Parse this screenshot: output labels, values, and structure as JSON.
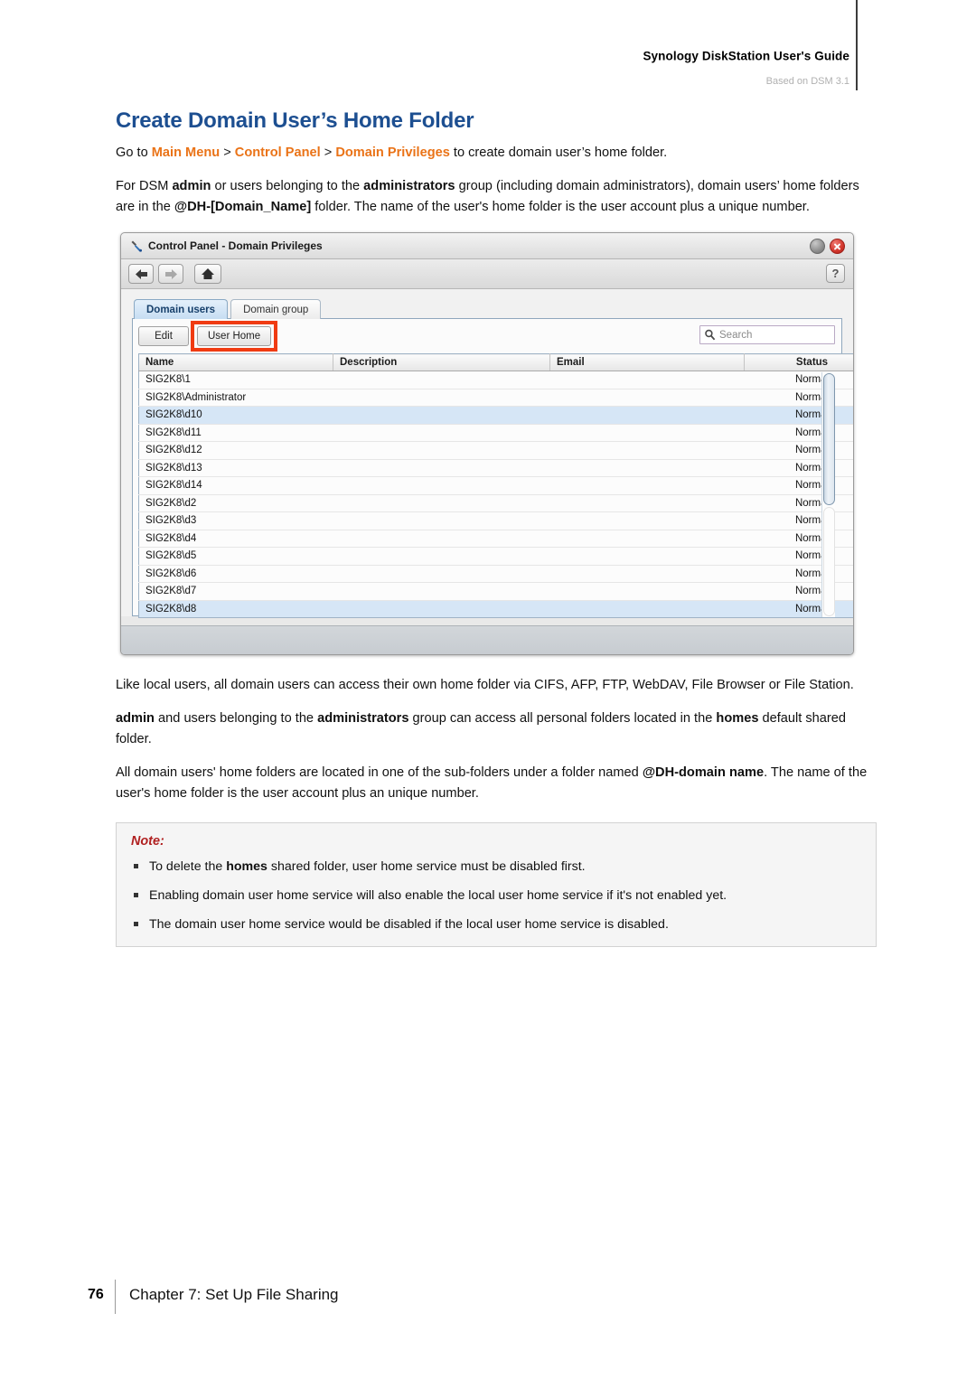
{
  "header": {
    "title": "Synology DiskStation User's Guide",
    "subtitle": "Based on DSM 3.1"
  },
  "page_title": "Create Domain User’s Home Folder",
  "intro": {
    "go_to_prefix": "Go to ",
    "nav1": "Main Menu",
    "nav_sep": " > ",
    "nav2": "Control Panel",
    "nav3": "Domain Privileges",
    "go_to_suffix": " to create domain user’s home folder."
  },
  "paragraph_admin": {
    "s1": "For DSM ",
    "b1": "admin",
    "s2": " or users belonging to the ",
    "b2": "administrators",
    "s3": " group (including domain administrators), domain users’ home folders are in the ",
    "b3": "@DH-[Domain_Name]",
    "s4": " folder. The name of the user's home folder is the user account plus a unique number."
  },
  "screenshot": {
    "window_title": "Control Panel - Domain Privileges",
    "title_icon": "wrench-icon",
    "minimize_label": "",
    "close_label": "",
    "help_label": "?",
    "toolbar": {
      "back": "back-arrow",
      "forward": "forward-arrow",
      "home": "home-icon"
    },
    "tabs": [
      {
        "label": "Domain users",
        "active": true
      },
      {
        "label": "Domain group",
        "active": false
      }
    ],
    "buttons": [
      {
        "label": "Edit",
        "highlighted": false
      },
      {
        "label": "User Home",
        "highlighted": true
      }
    ],
    "search": {
      "placeholder": "Search",
      "value": ""
    },
    "columns": [
      "Name",
      "Description",
      "Email",
      "Status"
    ],
    "rows": [
      {
        "name": "SIG2K8\\1",
        "description": "",
        "email": "",
        "status": "Normal",
        "selected": false
      },
      {
        "name": "SIG2K8\\Administrator",
        "description": "",
        "email": "",
        "status": "Normal",
        "selected": false
      },
      {
        "name": "SIG2K8\\d10",
        "description": "",
        "email": "",
        "status": "Normal",
        "selected": true
      },
      {
        "name": "SIG2K8\\d11",
        "description": "",
        "email": "",
        "status": "Normal",
        "selected": false
      },
      {
        "name": "SIG2K8\\d12",
        "description": "",
        "email": "",
        "status": "Normal",
        "selected": false
      },
      {
        "name": "SIG2K8\\d13",
        "description": "",
        "email": "",
        "status": "Normal",
        "selected": false
      },
      {
        "name": "SIG2K8\\d14",
        "description": "",
        "email": "",
        "status": "Normal",
        "selected": false
      },
      {
        "name": "SIG2K8\\d2",
        "description": "",
        "email": "",
        "status": "Normal",
        "selected": false
      },
      {
        "name": "SIG2K8\\d3",
        "description": "",
        "email": "",
        "status": "Normal",
        "selected": false
      },
      {
        "name": "SIG2K8\\d4",
        "description": "",
        "email": "",
        "status": "Normal",
        "selected": false
      },
      {
        "name": "SIG2K8\\d5",
        "description": "",
        "email": "",
        "status": "Normal",
        "selected": false
      },
      {
        "name": "SIG2K8\\d6",
        "description": "",
        "email": "",
        "status": "Normal",
        "selected": false
      },
      {
        "name": "SIG2K8\\d7",
        "description": "",
        "email": "",
        "status": "Normal",
        "selected": false
      },
      {
        "name": "SIG2K8\\d8",
        "description": "",
        "email": "",
        "status": "Normal",
        "selected": true
      }
    ],
    "highlight_color": "#f03b12"
  },
  "paragraph_access": {
    "s1": "Like local users, all domain users can access their own home folder via CIFS, AFP, FTP, WebDAV, File Browser or File Station."
  },
  "paragraph_homes": {
    "b1": "admin",
    "s1": " and users belonging to the ",
    "b2": "administrators",
    "s2": " group can access all personal folders located in the ",
    "b3": "homes",
    "s3": " default shared folder."
  },
  "paragraph_subfolders": {
    "s1": "All domain users' home folders are located in one of the sub-folders under a folder named ",
    "b1": "@DH-domain name",
    "s2": ". The name of the user's home folder is the user account plus an unique number."
  },
  "note": {
    "title": "Note:",
    "items": [
      {
        "s1": "To delete the ",
        "b1": "homes",
        "s2": " shared folder, user home service must be disabled first."
      },
      {
        "s1": "Enabling domain user home service will also enable the local user home service if it's not enabled yet.",
        "b1": "",
        "s2": ""
      },
      {
        "s1": "The domain user home service would be disabled if the local user home service is disabled.",
        "b1": "",
        "s2": ""
      }
    ]
  },
  "footer": {
    "page_number": "76",
    "chapter": "Chapter 7: Set Up File Sharing"
  },
  "colors": {
    "heading_blue": "#1d4f91",
    "nav_orange": "#ea7317",
    "note_red": "#b02020",
    "highlight_red": "#f03b12",
    "selected_row": "#d6e6f6"
  }
}
